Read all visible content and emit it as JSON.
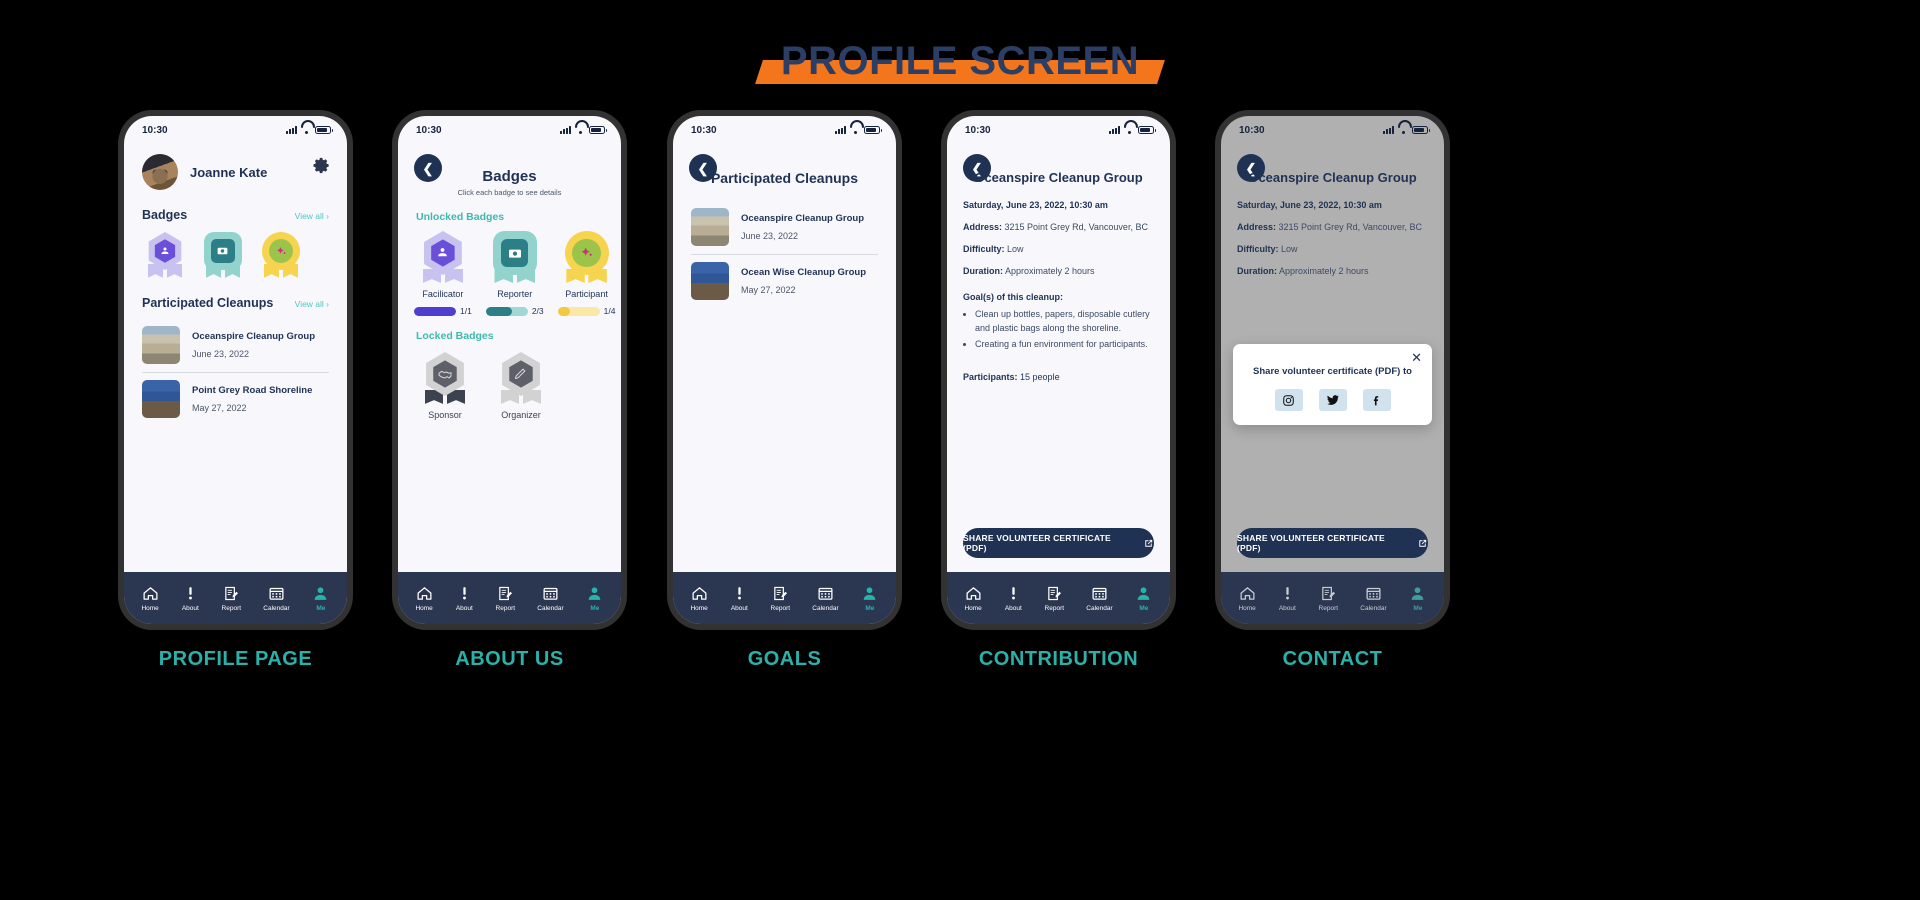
{
  "page": {
    "title": "PROFILE SCREEN",
    "accent_orange": "#f3761c",
    "accent_teal": "#2cb0aa",
    "navy": "#1f3254"
  },
  "status_bar": {
    "time": "10:30"
  },
  "nav": {
    "items": [
      {
        "label": "Home",
        "icon": "home-icon",
        "active": false
      },
      {
        "label": "About",
        "icon": "exclamation-icon",
        "active": false
      },
      {
        "label": "Report",
        "icon": "report-icon",
        "active": false
      },
      {
        "label": "Calendar",
        "icon": "calendar-icon",
        "active": false
      },
      {
        "label": "Me",
        "icon": "person-icon",
        "active": true
      }
    ]
  },
  "screens": [
    {
      "caption": "PROFILE PAGE",
      "user_name": "Joanne Kate",
      "settings_icon": "gear-icon",
      "sections": [
        {
          "title": "Badges",
          "view_all": "View all ›"
        },
        {
          "title": "Participated Cleanups",
          "view_all": "View all ›"
        }
      ],
      "badges_small": [
        {
          "name": "Facilicator",
          "icon": "facilitator-badge-icon"
        },
        {
          "name": "Reporter",
          "icon": "camera-badge-icon"
        },
        {
          "name": "Participant",
          "icon": "sparkle-badge-icon"
        }
      ],
      "cleanups": [
        {
          "title": "Oceanspire Cleanup Group",
          "date": "June 23, 2022"
        },
        {
          "title": "Point Grey Road Shoreline",
          "date": "May 27, 2022"
        }
      ]
    },
    {
      "caption": "ABOUT US",
      "title": "Badges",
      "subtitle": "Click each badge to see details",
      "unlocked_label": "Unlocked Badges",
      "locked_label": "Locked Badges",
      "unlocked": [
        {
          "name": "Facilicator",
          "progress": "1/1",
          "fill_pct": 100,
          "fill_color": "#4f3fcf",
          "track_color": "#c9c3f2"
        },
        {
          "name": "Reporter",
          "progress": "2/3",
          "fill_pct": 62,
          "fill_color": "#2d7f87",
          "track_color": "#9fd8d4"
        },
        {
          "name": "Participant",
          "progress": "1/4",
          "fill_pct": 30,
          "fill_color": "#f5c842",
          "track_color": "#fbe8a6"
        }
      ],
      "locked": [
        {
          "name": "Sponsor",
          "icon": "handshake-icon"
        },
        {
          "name": "Organizer",
          "icon": "pencil-icon"
        }
      ]
    },
    {
      "caption": "GOALS",
      "title": "Participated Cleanups",
      "cleanups": [
        {
          "title": "Oceanspire Cleanup Group",
          "date": "June 23, 2022"
        },
        {
          "title": "Ocean Wise Cleanup Group",
          "date": "May 27, 2022"
        }
      ]
    },
    {
      "caption": "CONTRIBUTION",
      "title": "Oceanspire Cleanup Group",
      "datetime": "Saturday, June 23, 2022, 10:30 am",
      "address_label": "Address:",
      "address_value": "3215 Point Grey Rd, Vancouver, BC",
      "difficulty_label": "Difficulty:",
      "difficulty_value": "Low",
      "duration_label": "Duration:",
      "duration_value": "Approximately 2 hours",
      "goals_label": "Goal(s) of this cleanup:",
      "goals": [
        "Clean up bottles, papers, disposable cutlery and plastic bags along the shoreline.",
        "Creating a fun environment for participants."
      ],
      "participants_label": "Participants:",
      "participants_value": "15 people",
      "share_button": "SHARE VOLUNTEER CERTIFICATE (PDF)"
    },
    {
      "caption": "CONTACT",
      "title": "Oceanspire Cleanup Group",
      "datetime": "Saturday, June 23, 2022, 10:30 am",
      "address_label": "Address:",
      "address_value": "3215 Point Grey Rd, Vancouver, BC",
      "difficulty_label": "Difficulty:",
      "difficulty_value": "Low",
      "duration_label": "Duration:",
      "duration_value": "Approximately 2 hours",
      "participants_label": "Participants:",
      "participants_value": "15 people",
      "share_button": "SHARE VOLUNTEER CERTIFICATE (PDF)",
      "modal": {
        "title": "Share volunteer certificate (PDF) to",
        "close_icon": "close-icon",
        "socials": [
          {
            "name": "instagram-icon"
          },
          {
            "name": "twitter-icon"
          },
          {
            "name": "facebook-icon"
          }
        ]
      }
    }
  ]
}
